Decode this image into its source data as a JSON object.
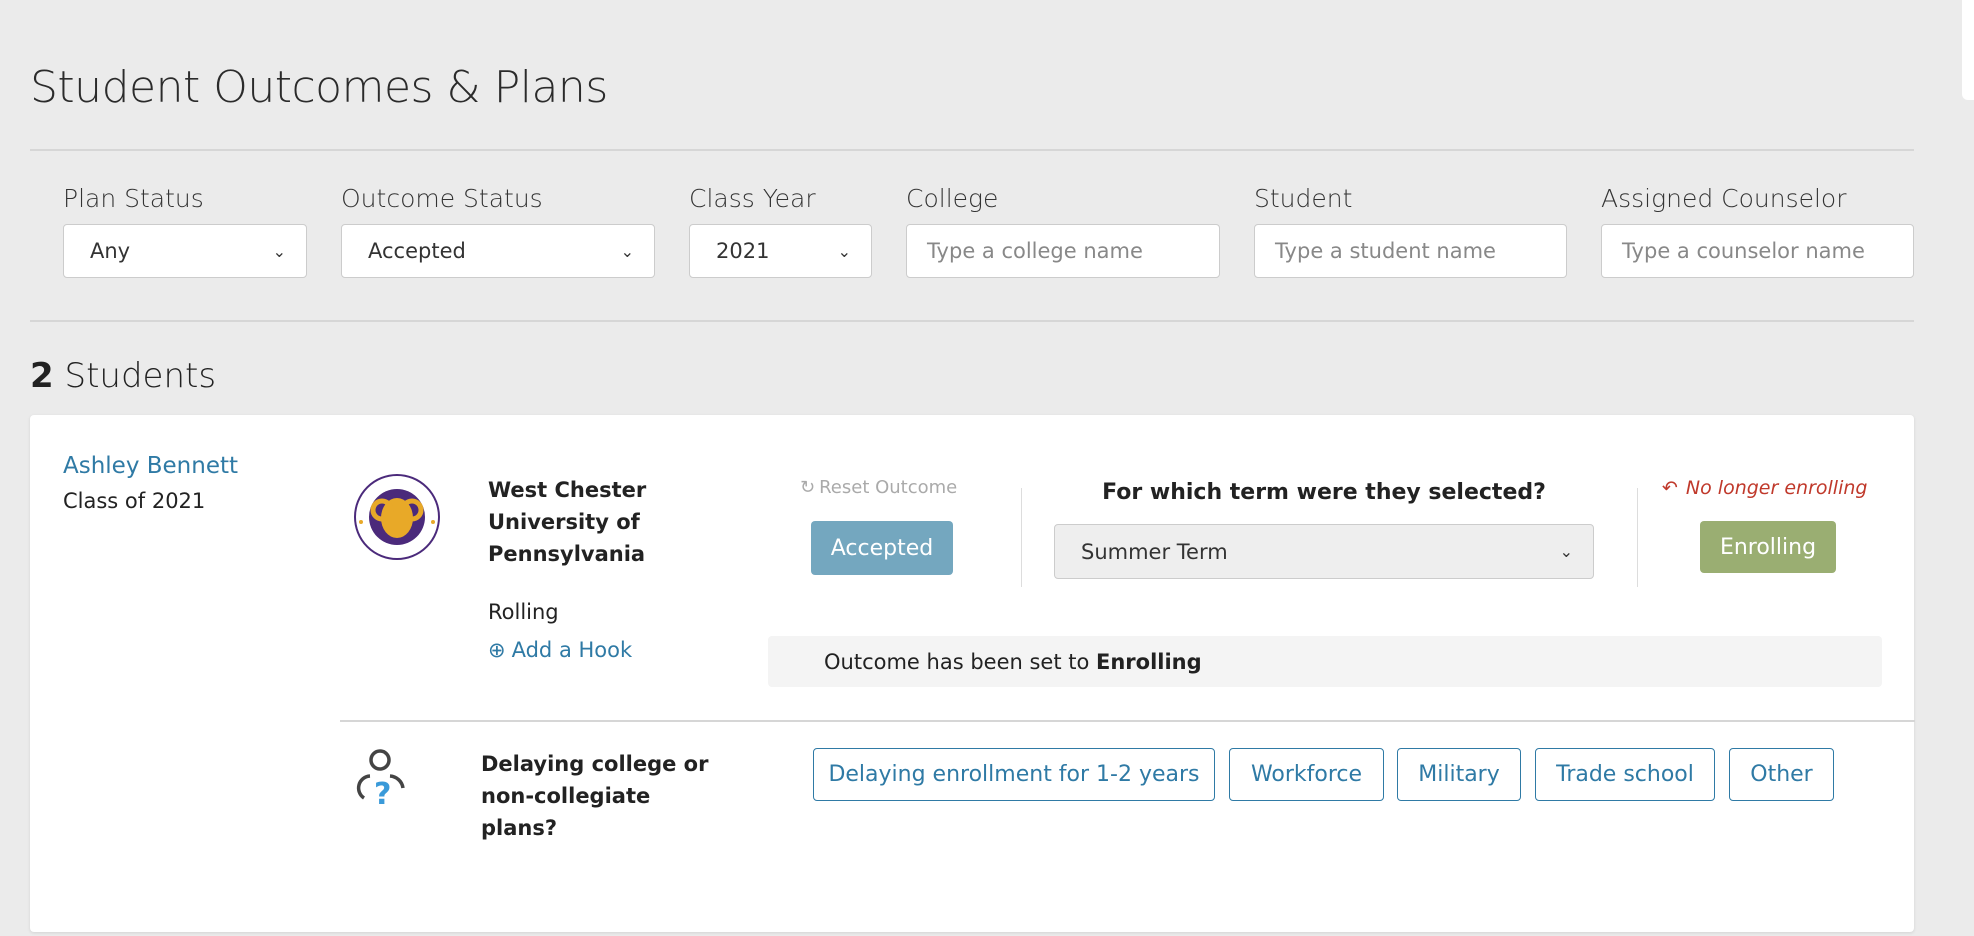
{
  "page": {
    "title": "Student Outcomes & Plans"
  },
  "filters": [
    {
      "label": "Plan Status",
      "value": "Any",
      "type": "select"
    },
    {
      "label": "Outcome Status",
      "value": "Accepted",
      "type": "select"
    },
    {
      "label": "Class Year",
      "value": "2021",
      "type": "select"
    },
    {
      "label": "College",
      "placeholder": "Type a college name",
      "type": "input"
    },
    {
      "label": "Student",
      "placeholder": "Type a student name",
      "type": "input"
    },
    {
      "label": "Assigned Counselor",
      "placeholder": "Type a counselor name",
      "type": "input"
    }
  ],
  "results": {
    "count": "2",
    "label": "Students"
  },
  "student": {
    "name": "Ashley Bennett",
    "class": "Class of 2021",
    "college": {
      "name_lines": [
        "West Chester",
        "University of",
        "Pennsylvania"
      ],
      "logo_text": "WEST CHESTER UNIVERSITY GOLDEN RAMS",
      "deadline": "Rolling",
      "add_hook": "Add a Hook"
    },
    "reset_outcome": "Reset Outcome",
    "accepted_label": "Accepted",
    "term_question": "For which term were they selected?",
    "term_value": "Summer Term",
    "no_longer_enrolling": "No longer enrolling",
    "enrolling_label": "Enrolling",
    "message_prefix": "Outcome has been set to ",
    "message_bold": "Enrolling",
    "delaying": {
      "lines": [
        "Delaying college or",
        "non-collegiate",
        "plans?"
      ],
      "options": [
        "Delaying enrollment for 1-2 years",
        "Workforce",
        "Military",
        "Trade school",
        "Other"
      ]
    }
  },
  "colors": {
    "accepted": "#74a7bf",
    "enrolling": "#9aae72",
    "link": "#2f7aa5",
    "warning": "#c0392b"
  }
}
